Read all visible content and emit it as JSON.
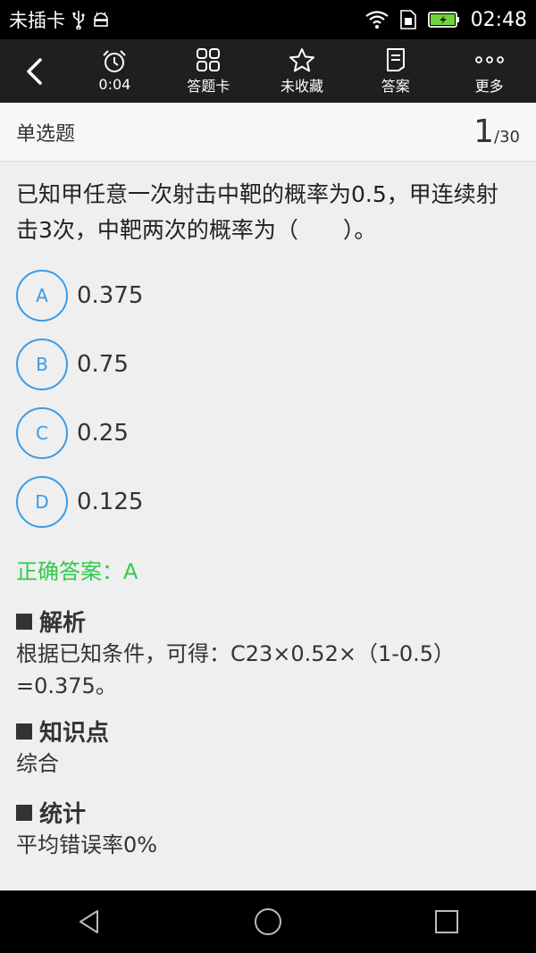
{
  "status": {
    "carrier": "未插卡",
    "time": "02:48"
  },
  "toolbar": {
    "timer_label": "0:04",
    "answer_card_label": "答题卡",
    "favorite_label": "未收藏",
    "answer_label": "答案",
    "more_label": "更多"
  },
  "question_header": {
    "type": "单选题",
    "current": "1",
    "total": "/30"
  },
  "question": {
    "text": "已知甲任意一次射击中靶的概率为0.5，甲连续射击3次，中靶两次的概率为（　　）。",
    "options": [
      {
        "letter": "A",
        "text": "0.375"
      },
      {
        "letter": "B",
        "text": "0.75"
      },
      {
        "letter": "C",
        "text": "0.25"
      },
      {
        "letter": "D",
        "text": "0.125"
      }
    ]
  },
  "answer": {
    "text": "正确答案：A"
  },
  "analysis": {
    "title": "解析",
    "body": "根据已知条件，可得：C23×0.52×（1-0.5）=0.375。"
  },
  "knowledge": {
    "title": "知识点",
    "body": "综合"
  },
  "stats": {
    "title": "统计",
    "body": "平均错误率0%"
  },
  "colors": {
    "accent": "#3a9be6",
    "correct": "#2ecc4a",
    "toolbar": "#1f1f1f"
  }
}
